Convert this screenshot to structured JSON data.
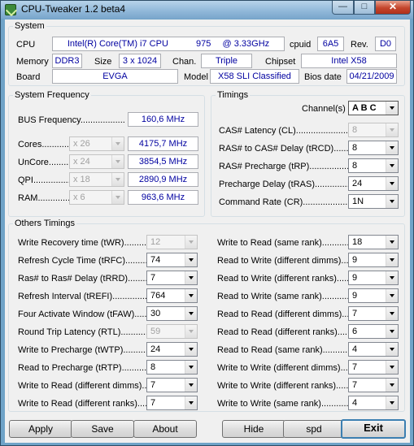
{
  "window": {
    "title": "CPU-Tweaker 1.2 beta4",
    "minimize": "—",
    "maximize": "□",
    "close": "✕"
  },
  "system": {
    "legend": "System",
    "cpu_label": "CPU",
    "cpu_name": "Intel(R) Core(TM) i7 CPU",
    "cpu_model": "975",
    "cpu_freq": "@ 3.33GHz",
    "cpuid_label": "cpuid",
    "cpuid": "6A5",
    "rev_label": "Rev.",
    "rev": "D0",
    "memory_label": "Memory",
    "memory_type": "DDR3",
    "size_label": "Size",
    "size": "3 x 1024",
    "chan_label": "Chan.",
    "channels": "Triple",
    "chipset_label": "Chipset",
    "chipset": "Intel X58",
    "board_label": "Board",
    "board_vendor": "EVGA",
    "model_label": "Model",
    "model": "X58 SLI Classified",
    "bios_label": "Bios date",
    "bios_date": "04/21/2009"
  },
  "freq": {
    "legend": "System Frequency",
    "bus_label": "BUS Frequency..................",
    "bus_value": "160,6 MHz",
    "rows": [
      {
        "label": "Cores............",
        "mult": "x 26",
        "value": "4175,7 MHz"
      },
      {
        "label": "UnCore..........",
        "mult": "x 24",
        "value": "3854,5 MHz"
      },
      {
        "label": "QPI...............",
        "mult": "x 18",
        "value": "2890,9 MHz"
      },
      {
        "label": "RAM..............",
        "mult": "x 6",
        "value": "963,6 MHz"
      }
    ]
  },
  "timings": {
    "legend": "Timings",
    "channels_label": "Channel(s)",
    "channels_value": "A B C",
    "rows": [
      {
        "label": "CAS# Latency (CL)......................",
        "value": "8",
        "disabled": true
      },
      {
        "label": "RAS# to CAS# Delay (tRCD).........",
        "value": "8",
        "disabled": false
      },
      {
        "label": "RAS# Precharge (tRP)................",
        "value": "8",
        "disabled": false
      },
      {
        "label": "Precharge Delay (tRAS)..............",
        "value": "24",
        "disabled": false
      },
      {
        "label": "Command Rate (CR)..................",
        "value": "1N",
        "disabled": false
      }
    ]
  },
  "others": {
    "legend": "Others Timings",
    "left": [
      {
        "label": "Write Recovery time (tWR)..........",
        "value": "12",
        "disabled": true
      },
      {
        "label": "Refresh Cycle Time (tRFC)...........",
        "value": "74",
        "disabled": false
      },
      {
        "label": "Ras# to Ras# Delay (tRRD)...........",
        "value": "7",
        "disabled": false
      },
      {
        "label": "Refresh Interval (tREFI)...............",
        "value": "764",
        "disabled": false
      },
      {
        "label": "Four Activate Window (tFAW).........",
        "value": "30",
        "disabled": false
      },
      {
        "label": "Round Trip Latency (RTL)...............",
        "value": "59",
        "disabled": true
      },
      {
        "label": "Write to Precharge (tWTP)............",
        "value": "24",
        "disabled": false
      },
      {
        "label": "Read to Precharge (tRTP)............",
        "value": "8",
        "disabled": false
      },
      {
        "label": "Write to Read (different dimms)...",
        "value": "7",
        "disabled": false
      },
      {
        "label": "Write to Read (different ranks)....",
        "value": "7",
        "disabled": false
      }
    ],
    "right": [
      {
        "label": "Write to Read (same rank)..............",
        "value": "18"
      },
      {
        "label": "Read to Write (different dimms)......",
        "value": "9"
      },
      {
        "label": "Read to Write (different ranks)......",
        "value": "9"
      },
      {
        "label": "Read to Write (same rank)..............",
        "value": "9"
      },
      {
        "label": "Read to Read (different dimms)......",
        "value": "7"
      },
      {
        "label": "Read to Read (different ranks)......",
        "value": "6"
      },
      {
        "label": "Read to Read (same rank)..............",
        "value": "4"
      },
      {
        "label": "Write to Write (different dimms).....",
        "value": "7"
      },
      {
        "label": "Write to Write (different ranks).....",
        "value": "7"
      },
      {
        "label": "Write to Write (same rank).............",
        "value": "4"
      }
    ]
  },
  "buttons": {
    "apply": "Apply",
    "save": "Save",
    "about": "About",
    "hide": "Hide",
    "spd": "spd",
    "exit": "Exit"
  }
}
